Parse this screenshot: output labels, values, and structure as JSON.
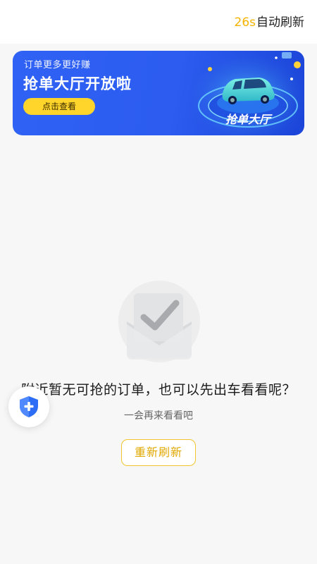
{
  "header": {
    "countdown": "26s",
    "auto_refresh_label": "自动刷新"
  },
  "banner": {
    "subtitle": "订单更多更好赚",
    "title": "抢单大厅开放啦",
    "button_label": "点击查看",
    "art_caption": "抢单大厅",
    "colors": {
      "background": "#2f62f5",
      "button": "#ffd42b"
    }
  },
  "empty_state": {
    "icon": "check-envelope-icon",
    "title": "附近暂无可抢的订单，也可以先出车看看呢？",
    "subtitle": "一会再来看看吧",
    "refresh_button": "重新刷新"
  },
  "floating": {
    "icon": "shield-plus-icon"
  },
  "colors": {
    "accent": "#f5b400",
    "shield": "#2d6df6"
  }
}
